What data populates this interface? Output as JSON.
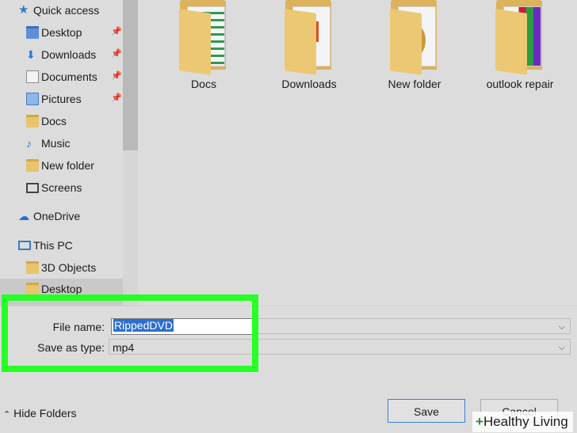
{
  "sidebar": {
    "items": [
      {
        "label": "Quick access",
        "icon": "star-icon"
      },
      {
        "label": "Desktop",
        "icon": "folder-blue-icon",
        "pinned": true
      },
      {
        "label": "Downloads",
        "icon": "download-icon",
        "pinned": true
      },
      {
        "label": "Documents",
        "icon": "documents-icon",
        "pinned": true
      },
      {
        "label": "Pictures",
        "icon": "pictures-icon",
        "pinned": true
      },
      {
        "label": "Docs",
        "icon": "folder-icon"
      },
      {
        "label": "Music",
        "icon": "music-icon"
      },
      {
        "label": "New folder",
        "icon": "folder-icon"
      },
      {
        "label": "Screens",
        "icon": "monitor-icon"
      },
      {
        "label": "OneDrive",
        "icon": "cloud-icon"
      },
      {
        "label": "This PC",
        "icon": "computer-icon"
      },
      {
        "label": "3D Objects",
        "icon": "cube-icon"
      },
      {
        "label": "Desktop",
        "icon": "folder-blue-icon"
      }
    ]
  },
  "folders": [
    {
      "label": "Docs"
    },
    {
      "label": "Downloads"
    },
    {
      "label": "New folder"
    },
    {
      "label": "outlook repair"
    }
  ],
  "form": {
    "filename_label": "File name:",
    "filename_value": "RippedDVD",
    "type_label": "Save as type:",
    "type_value": "mp4"
  },
  "buttons": {
    "save": "Save",
    "cancel": "Cancel"
  },
  "hide_folders": "Hide Folders",
  "watermark": "Healthy Living",
  "colors": {
    "highlight": "#27ff27",
    "selection": "#2b6fd1"
  }
}
